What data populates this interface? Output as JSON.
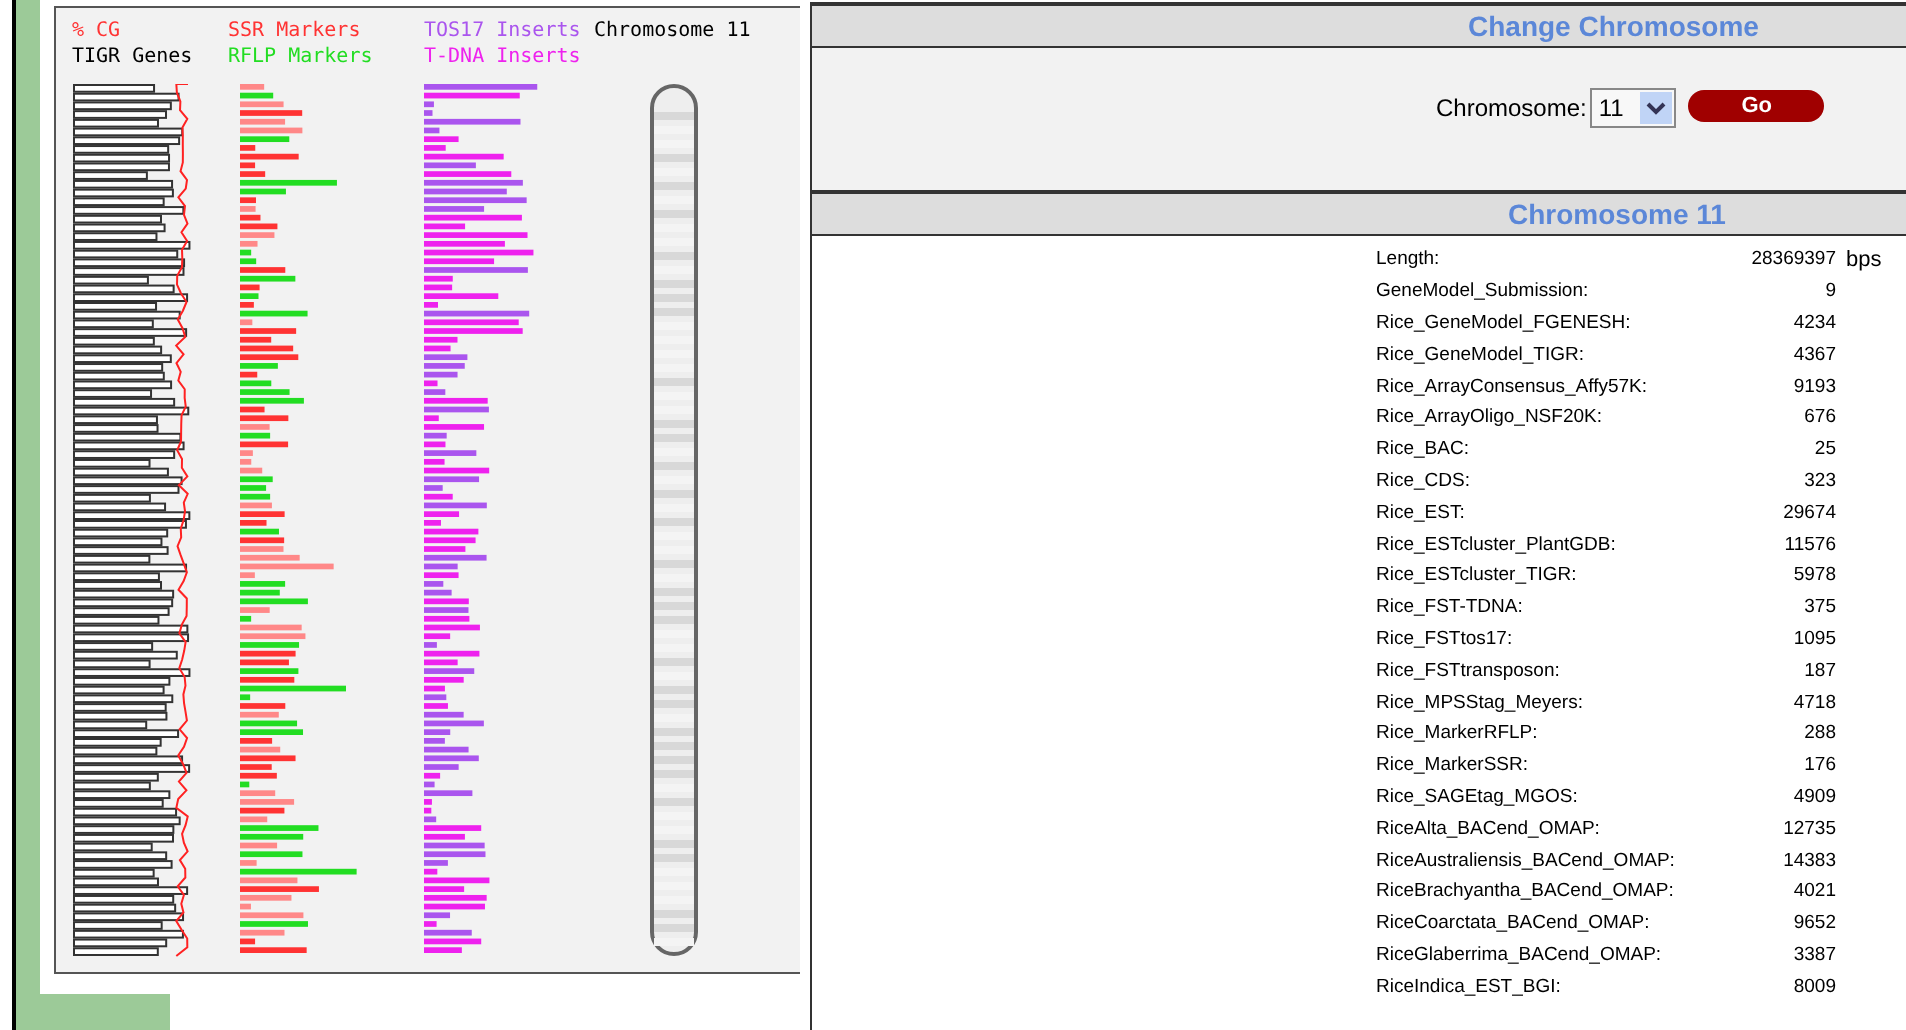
{
  "legend": [
    {
      "label": "% CG",
      "color": "#ff3333"
    },
    {
      "label": "SSR Markers",
      "color": "#ff3333"
    },
    {
      "label": "TOS17 Inserts",
      "color": "#aa55ee"
    },
    {
      "label": "Chromosome 11",
      "color": "#000000"
    },
    {
      "label": "TIGR Genes",
      "color": "#000000"
    },
    {
      "label": "RFLP Markers",
      "color": "#22dd22"
    },
    {
      "label": "T-DNA Inserts",
      "color": "#ee22ee"
    }
  ],
  "change_panel": {
    "title": "Change Chromosome",
    "select_label": "Chromosome:",
    "select_value": "11",
    "button": "Go"
  },
  "stats_panel": {
    "title": "Chromosome 11",
    "rows": [
      {
        "label": "Length:",
        "value": "28369397",
        "unit": "bps"
      },
      {
        "label": "GeneModel_Submission:",
        "value": "9"
      },
      {
        "label": "Rice_GeneModel_FGENESH:",
        "value": "4234"
      },
      {
        "label": "Rice_GeneModel_TIGR:",
        "value": "4367"
      },
      {
        "label": "Rice_ArrayConsensus_Affy57K:",
        "value": "9193"
      },
      {
        "label": "Rice_ArrayOligo_NSF20K:",
        "value": "676"
      },
      {
        "label": "Rice_BAC:",
        "value": "25"
      },
      {
        "label": "Rice_CDS:",
        "value": "323"
      },
      {
        "label": "Rice_EST:",
        "value": "29674"
      },
      {
        "label": "Rice_ESTcluster_PlantGDB:",
        "value": "11576"
      },
      {
        "label": "Rice_ESTcluster_TIGR:",
        "value": "5978"
      },
      {
        "label": "Rice_FST-TDNA:",
        "value": "375"
      },
      {
        "label": "Rice_FSTtos17:",
        "value": "1095"
      },
      {
        "label": "Rice_FSTtransposon:",
        "value": "187"
      },
      {
        "label": "Rice_MPSStag_Meyers:",
        "value": "4718"
      },
      {
        "label": "Rice_MarkerRFLP:",
        "value": "288"
      },
      {
        "label": "Rice_MarkerSSR:",
        "value": "176"
      },
      {
        "label": "Rice_SAGEtag_MGOS:",
        "value": "4909"
      },
      {
        "label": "RiceAlta_BACend_OMAP:",
        "value": "12735"
      },
      {
        "label": "RiceAustraliensis_BACend_OMAP:",
        "value": "14383"
      },
      {
        "label": "RiceBrachyantha_BACend_OMAP:",
        "value": "4021"
      },
      {
        "label": "RiceCoarctata_BACend_OMAP:",
        "value": "9652"
      },
      {
        "label": "RiceGlaberrima_BACend_OMAP:",
        "value": "3387"
      },
      {
        "label": "RiceIndica_EST_BGI:",
        "value": "8009"
      }
    ]
  }
}
